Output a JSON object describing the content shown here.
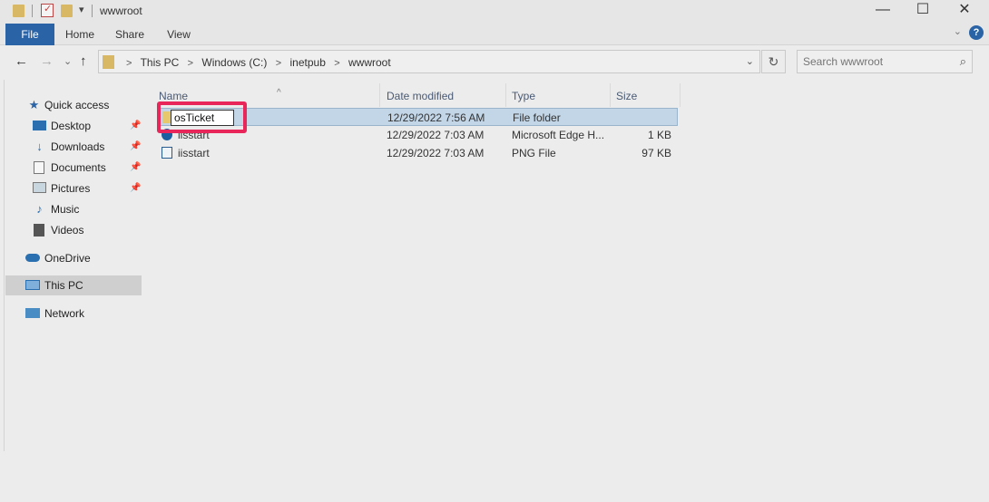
{
  "window": {
    "title": "wwwroot"
  },
  "titlebar": {
    "minimize": "—",
    "maximize": "☐",
    "close": "✕",
    "dropdown": "▾"
  },
  "ribbon": {
    "tabs": [
      "File",
      "Home",
      "Share",
      "View"
    ],
    "help": "?",
    "collapse": "⌄"
  },
  "nav": {
    "back": "←",
    "forward": "→",
    "recent": "⌄",
    "up": "↑",
    "breadcrumbs": [
      "This PC",
      "Windows (C:)",
      "inetpub",
      "wwwroot"
    ],
    "crumb_sep": ">",
    "dropdown": "⌄",
    "refresh": "↻"
  },
  "search": {
    "placeholder": "Search wwwroot",
    "icon": "search-icon"
  },
  "sidebar": {
    "items": [
      {
        "label": "Quick access",
        "icon": "star-icon",
        "pinned": false
      },
      {
        "label": "Desktop",
        "icon": "desktop-icon",
        "pinned": true
      },
      {
        "label": "Downloads",
        "icon": "download-icon",
        "pinned": true
      },
      {
        "label": "Documents",
        "icon": "documents-icon",
        "pinned": true
      },
      {
        "label": "Pictures",
        "icon": "pictures-icon",
        "pinned": true
      },
      {
        "label": "Music",
        "icon": "music-icon",
        "pinned": false
      },
      {
        "label": "Videos",
        "icon": "videos-icon",
        "pinned": false
      },
      {
        "label": "OneDrive",
        "icon": "cloud-icon",
        "pinned": false
      },
      {
        "label": "This PC",
        "icon": "computer-icon",
        "pinned": false,
        "selected": true
      },
      {
        "label": "Network",
        "icon": "network-icon",
        "pinned": false
      }
    ],
    "pin_glyph": "📌"
  },
  "columns": {
    "name": "Name",
    "date": "Date modified",
    "type": "Type",
    "size": "Size",
    "sort": "^"
  },
  "files": [
    {
      "name": "osTicket",
      "date": "12/29/2022 7:56 AM",
      "type": "File folder",
      "size": "",
      "icon": "folder-icon",
      "renaming": true
    },
    {
      "name": "iisstart",
      "date": "12/29/2022 7:03 AM",
      "type": "Microsoft Edge H...",
      "size": "1 KB",
      "icon": "edge-icon"
    },
    {
      "name": "iisstart",
      "date": "12/29/2022 7:03 AM",
      "type": "PNG File",
      "size": "97 KB",
      "icon": "image-icon"
    }
  ],
  "colors": {
    "accent": "#2a63a6",
    "highlight": "#e8265a",
    "folder": "#d9b865",
    "selection": "#c2d6e8"
  }
}
